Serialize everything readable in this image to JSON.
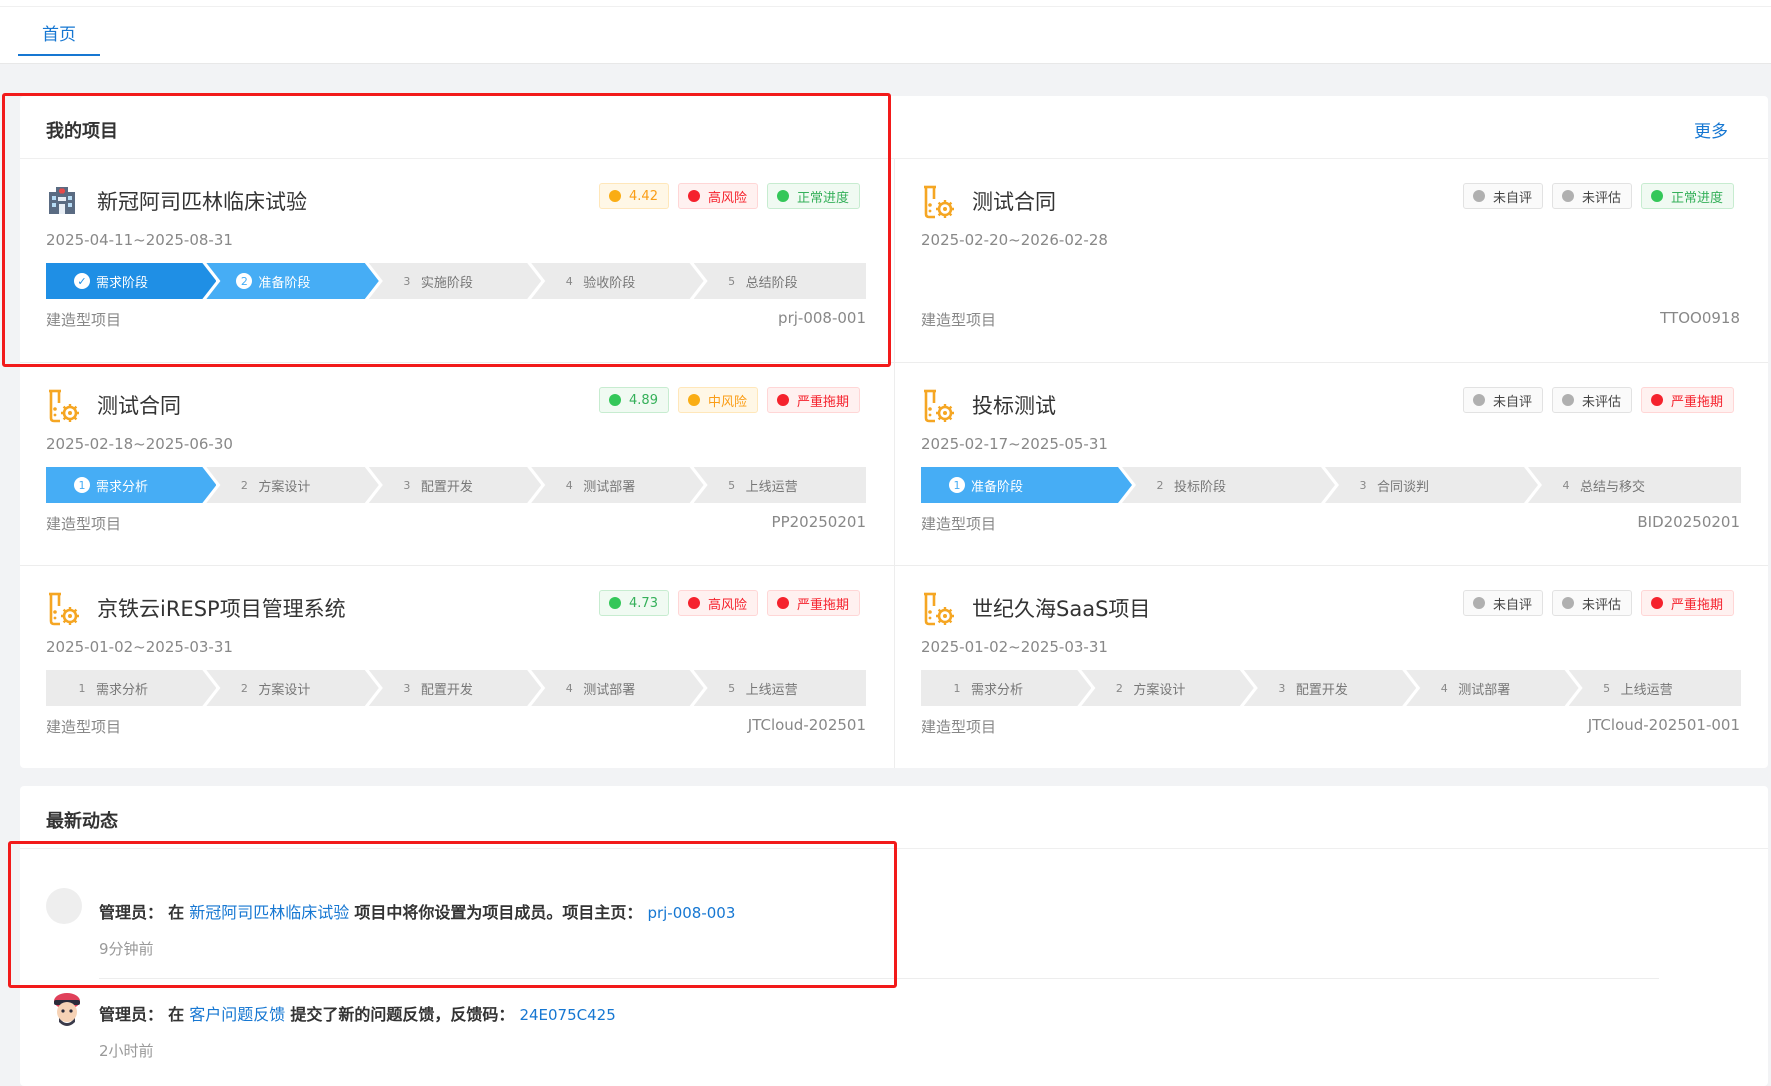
{
  "top_tabs": {
    "home": "首页"
  },
  "projects": {
    "title": "我的项目",
    "more": "更多",
    "cards": [
      {
        "name": "新冠阿司匹林临床试验",
        "icon": "hospital-icon",
        "dates": "2025-04-11~2025-08-31",
        "type": "建造型项目",
        "code": "prj-008-001",
        "badges": [
          {
            "text": "4.42",
            "color": "orange"
          },
          {
            "text": "高风险",
            "color": "red"
          },
          {
            "text": "正常进度",
            "color": "green"
          }
        ],
        "steps": [
          {
            "num": "✓",
            "label": "需求阶段",
            "state": "done"
          },
          {
            "num": "2",
            "label": "准备阶段",
            "state": "active"
          },
          {
            "num": "3",
            "label": "实施阶段",
            "state": "todo"
          },
          {
            "num": "4",
            "label": "验收阶段",
            "state": "todo"
          },
          {
            "num": "5",
            "label": "总结阶段",
            "state": "todo"
          }
        ]
      },
      {
        "name": "测试合同",
        "icon": "flask-gear-icon",
        "dates": "2025-02-20~2026-02-28",
        "type": "建造型项目",
        "code": "TTOO0918",
        "badges": [
          {
            "text": "未自评",
            "color": "gray"
          },
          {
            "text": "未评估",
            "color": "gray"
          },
          {
            "text": "正常进度",
            "color": "green"
          }
        ],
        "steps": []
      },
      {
        "name": "测试合同",
        "icon": "flask-gear-icon",
        "dates": "2025-02-18~2025-06-30",
        "type": "建造型项目",
        "code": "PP20250201",
        "badges": [
          {
            "text": "4.89",
            "color": "green"
          },
          {
            "text": "中风险",
            "color": "orange"
          },
          {
            "text": "严重拖期",
            "color": "red"
          }
        ],
        "steps": [
          {
            "num": "1",
            "label": "需求分析",
            "state": "active"
          },
          {
            "num": "2",
            "label": "方案设计",
            "state": "todo"
          },
          {
            "num": "3",
            "label": "配置开发",
            "state": "todo"
          },
          {
            "num": "4",
            "label": "测试部署",
            "state": "todo"
          },
          {
            "num": "5",
            "label": "上线运营",
            "state": "todo"
          }
        ]
      },
      {
        "name": "投标测试",
        "icon": "flask-gear-icon",
        "dates": "2025-02-17~2025-05-31",
        "type": "建造型项目",
        "code": "BID20250201",
        "badges": [
          {
            "text": "未自评",
            "color": "gray"
          },
          {
            "text": "未评估",
            "color": "gray"
          },
          {
            "text": "严重拖期",
            "color": "red"
          }
        ],
        "steps": [
          {
            "num": "1",
            "label": "准备阶段",
            "state": "active"
          },
          {
            "num": "2",
            "label": "投标阶段",
            "state": "todo"
          },
          {
            "num": "3",
            "label": "合同谈判",
            "state": "todo"
          },
          {
            "num": "4",
            "label": "总结与移交",
            "state": "todo"
          }
        ]
      },
      {
        "name": "京铁云iRESP项目管理系统",
        "icon": "flask-gear-icon",
        "dates": "2025-01-02~2025-03-31",
        "type": "建造型项目",
        "code": "JTCloud-202501",
        "badges": [
          {
            "text": "4.73",
            "color": "green"
          },
          {
            "text": "高风险",
            "color": "red"
          },
          {
            "text": "严重拖期",
            "color": "red"
          }
        ],
        "steps": [
          {
            "num": "1",
            "label": "需求分析",
            "state": "todo"
          },
          {
            "num": "2",
            "label": "方案设计",
            "state": "todo"
          },
          {
            "num": "3",
            "label": "配置开发",
            "state": "todo"
          },
          {
            "num": "4",
            "label": "测试部署",
            "state": "todo"
          },
          {
            "num": "5",
            "label": "上线运营",
            "state": "todo"
          }
        ]
      },
      {
        "name": "世纪久海SaaS项目",
        "icon": "flask-gear-icon",
        "dates": "2025-01-02~2025-03-31",
        "type": "建造型项目",
        "code": "JTCloud-202501-001",
        "badges": [
          {
            "text": "未自评",
            "color": "gray"
          },
          {
            "text": "未评估",
            "color": "gray"
          },
          {
            "text": "严重拖期",
            "color": "red"
          }
        ],
        "steps": [
          {
            "num": "1",
            "label": "需求分析",
            "state": "todo"
          },
          {
            "num": "2",
            "label": "方案设计",
            "state": "todo"
          },
          {
            "num": "3",
            "label": "配置开发",
            "state": "todo"
          },
          {
            "num": "4",
            "label": "测试部署",
            "state": "todo"
          },
          {
            "num": "5",
            "label": "上线运营",
            "state": "todo"
          }
        ]
      }
    ]
  },
  "feed": {
    "title": "最新动态",
    "items": [
      {
        "actor": "管理员：",
        "pre": "在",
        "target": "新冠阿司匹林临床试验",
        "action": "项目中将你设置为项目成员。项目主页：",
        "code": "prj-008-003",
        "time": "9分钟前",
        "avatar": "blank-avatar"
      },
      {
        "actor": "管理员：",
        "pre": "在",
        "target": "客户问题反馈",
        "action": "提交了新的问题反馈，反馈码：",
        "code": "24E075C425",
        "time": "2小时前",
        "avatar": "cartoon-avatar"
      }
    ]
  }
}
